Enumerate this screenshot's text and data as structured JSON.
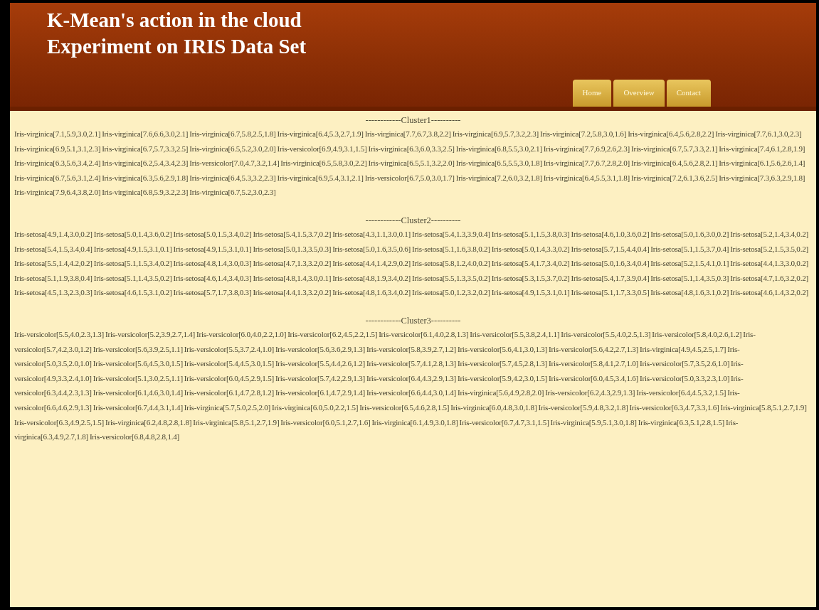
{
  "header": {
    "title_lines": [
      "K-Mean's action in the cloud",
      "Experiment on IRIS Data Set"
    ]
  },
  "nav": [
    "Home",
    "Overview",
    "Contact"
  ],
  "clusters": [
    {
      "heading": "------------Cluster1----------",
      "text": "Iris-virginica[7.1,5.9,3.0,2.1] Iris-virginica[7.6,6.6,3.0,2.1] Iris-virginica[6.7,5.8,2.5,1.8] Iris-virginica[6.4,5.3,2.7,1.9] Iris-virginica[7.7,6.7,3.8,2.2] Iris-virginica[6.9,5.7,3.2,2.3] Iris-virginica[7.2,5.8,3.0,1.6] Iris-virginica[6.4,5.6,2.8,2.2] Iris-virginica[7.7,6.1,3.0,2.3] Iris-virginica[6.9,5.1,3.1,2.3] Iris-virginica[6.7,5.7,3.3,2.5] Iris-virginica[6.5,5.2,3.0,2.0] Iris-versicolor[6.9,4.9,3.1,1.5] Iris-virginica[6.3,6.0,3.3,2.5] Iris-virginica[6.8,5.5,3.0,2.1] Iris-virginica[7.7,6.9,2.6,2.3] Iris-virginica[6.7,5.7,3.3,2.1] Iris-virginica[7.4,6.1,2.8,1.9] Iris-virginica[6.3,5.6,3.4,2.4] Iris-virginica[6.2,5.4,3.4,2.3] Iris-versicolor[7.0,4.7,3.2,1.4] Iris-virginica[6.5,5.8,3.0,2.2] Iris-virginica[6.5,5.1,3.2,2.0] Iris-virginica[6.5,5.5,3.0,1.8] Iris-virginica[7.7,6.7,2.8,2.0] Iris-virginica[6.4,5.6,2.8,2.1] Iris-virginica[6.1,5.6,2.6,1.4] Iris-virginica[6.7,5.6,3.1,2.4] Iris-virginica[6.3,5.6,2.9,1.8] Iris-virginica[6.4,5.3,3.2,2.3] Iris-virginica[6.9,5.4,3.1,2.1] Iris-versicolor[6.7,5.0,3.0,1.7] Iris-virginica[7.2,6.0,3.2,1.8] Iris-virginica[6.4,5.5,3.1,1.8] Iris-virginica[7.2,6.1,3.6,2.5] Iris-virginica[7.3,6.3,2.9,1.8] Iris-virginica[7.9,6.4,3.8,2.0] Iris-virginica[6.8,5.9,3.2,2.3] Iris-virginica[6.7,5.2,3.0,2.3]"
    },
    {
      "heading": "------------Cluster2----------",
      "text": "Iris-setosa[4.9,1.4,3.0,0.2] Iris-setosa[5.0,1.4,3.6,0.2] Iris-setosa[5.0,1.5,3.4,0.2] Iris-setosa[5.4,1.5,3.7,0.2] Iris-setosa[4.3,1.1,3.0,0.1] Iris-setosa[5.4,1.3,3.9,0.4] Iris-setosa[5.1,1.5,3.8,0.3] Iris-setosa[4.6,1.0,3.6,0.2] Iris-setosa[5.0,1.6,3.0,0.2] Iris-setosa[5.2,1.4,3.4,0.2] Iris-setosa[5.4,1.5,3.4,0.4] Iris-setosa[4.9,1.5,3.1,0.1] Iris-setosa[4.9,1.5,3.1,0.1] Iris-setosa[5.0,1.3,3.5,0.3] Iris-setosa[5.0,1.6,3.5,0.6] Iris-setosa[5.1,1.6,3.8,0.2] Iris-setosa[5.0,1.4,3.3,0.2] Iris-setosa[5.7,1.5,4.4,0.4] Iris-setosa[5.1,1.5,3.7,0.4] Iris-setosa[5.2,1.5,3.5,0.2] Iris-setosa[5.5,1.4,4.2,0.2] Iris-setosa[5.1,1.5,3.4,0.2] Iris-setosa[4.8,1.4,3.0,0.3] Iris-setosa[4.7,1.3,3.2,0.2] Iris-setosa[4.4,1.4,2.9,0.2] Iris-setosa[5.8,1.2,4.0,0.2] Iris-setosa[5.4,1.7,3.4,0.2] Iris-setosa[5.0,1.6,3.4,0.4] Iris-setosa[5.2,1.5,4.1,0.1] Iris-setosa[4.4,1.3,3.0,0.2] Iris-setosa[5.1,1.9,3.8,0.4] Iris-setosa[5.1,1.4,3.5,0.2] Iris-setosa[4.6,1.4,3.4,0.3] Iris-setosa[4.8,1.4,3.0,0.1] Iris-setosa[4.8,1.9,3.4,0.2] Iris-setosa[5.5,1.3,3.5,0.2] Iris-setosa[5.3,1.5,3.7,0.2] Iris-setosa[5.4,1.7,3.9,0.4] Iris-setosa[5.1,1.4,3.5,0.3] Iris-setosa[4.7,1.6,3.2,0.2] Iris-setosa[4.5,1.3,2.3,0.3] Iris-setosa[4.6,1.5,3.1,0.2] Iris-setosa[5.7,1.7,3.8,0.3] Iris-setosa[4.4,1.3,3.2,0.2] Iris-setosa[4.8,1.6,3.4,0.2] Iris-setosa[5.0,1.2,3.2,0.2] Iris-setosa[4.9,1.5,3.1,0.1] Iris-setosa[5.1,1.7,3.3,0.5] Iris-setosa[4.8,1.6,3.1,0.2] Iris-setosa[4.6,1.4,3.2,0.2]"
    },
    {
      "heading": "------------Cluster3----------",
      "text": "Iris-versicolor[5.5,4.0,2.3,1.3] Iris-versicolor[5.2,3.9,2.7,1.4] Iris-versicolor[6.0,4.0,2.2,1.0] Iris-versicolor[6.2,4.5,2.2,1.5] Iris-versicolor[6.1,4.0,2.8,1.3] Iris-versicolor[5.5,3.8,2.4,1.1] Iris-versicolor[5.5,4.0,2.5,1.3] Iris-versicolor[5.8,4.0,2.6,1.2] Iris-versicolor[5.7,4.2,3.0,1.2] Iris-versicolor[5.6,3.9,2.5,1.1] Iris-versicolor[5.5,3.7,2.4,1.0] Iris-versicolor[5.6,3.6,2.9,1.3] Iris-versicolor[5.8,3.9,2.7,1.2] Iris-versicolor[5.6,4.1,3.0,1.3] Iris-versicolor[5.6,4.2,2.7,1.3] Iris-virginica[4.9,4.5,2.5,1.7] Iris-versicolor[5.0,3.5,2.0,1.0] Iris-versicolor[5.6,4.5,3.0,1.5] Iris-versicolor[5.4,4.5,3.0,1.5] Iris-versicolor[5.5,4.4,2.6,1.2] Iris-versicolor[5.7,4.1,2.8,1.3] Iris-versicolor[5.7,4.5,2.8,1.3] Iris-versicolor[5.8,4.1,2.7,1.0] Iris-versicolor[5.7,3.5,2.6,1.0] Iris-versicolor[4.9,3.3,2.4,1.0] Iris-versicolor[5.1,3.0,2.5,1.1] Iris-versicolor[6.0,4.5,2.9,1.5] Iris-versicolor[5.7,4.2,2.9,1.3] Iris-versicolor[6.4,4.3,2.9,1.3] Iris-versicolor[5.9,4.2,3.0,1.5] Iris-versicolor[6.0,4.5,3.4,1.6] Iris-versicolor[5.0,3.3,2.3,1.0] Iris-versicolor[6.3,4.4,2.3,1.3] Iris-versicolor[6.1,4.6,3.0,1.4] Iris-versicolor[6.1,4.7,2.8,1.2] Iris-versicolor[6.1,4.7,2.9,1.4] Iris-versicolor[6.6,4.4,3.0,1.4] Iris-virginica[5.6,4.9,2.8,2.0] Iris-versicolor[6.2,4.3,2.9,1.3] Iris-versicolor[6.4,4.5,3.2,1.5] Iris-versicolor[6.6,4.6,2.9,1.3] Iris-versicolor[6.7,4.4,3.1,1.4] Iris-virginica[5.7,5.0,2.5,2.0] Iris-virginica[6.0,5.0,2.2,1.5] Iris-versicolor[6.5,4.6,2.8,1.5] Iris-virginica[6.0,4.8,3.0,1.8] Iris-versicolor[5.9,4.8,3.2,1.8] Iris-versicolor[6.3,4.7,3.3,1.6] Iris-virginica[5.8,5.1,2.7,1.9] Iris-versicolor[6.3,4.9,2.5,1.5] Iris-virginica[6.2,4.8,2.8,1.8] Iris-virginica[5.8,5.1,2.7,1.9] Iris-versicolor[6.0,5.1,2.7,1.6] Iris-virginica[6.1,4.9,3.0,1.8] Iris-versicolor[6.7,4.7,3.1,1.5] Iris-virginica[5.9,5.1,3.0,1.8] Iris-virginica[6.3,5.1,2.8,1.5] Iris-virginica[6.3,4.9,2.7,1.8] Iris-versicolor[6.8,4.8,2.8,1.4]"
    }
  ]
}
